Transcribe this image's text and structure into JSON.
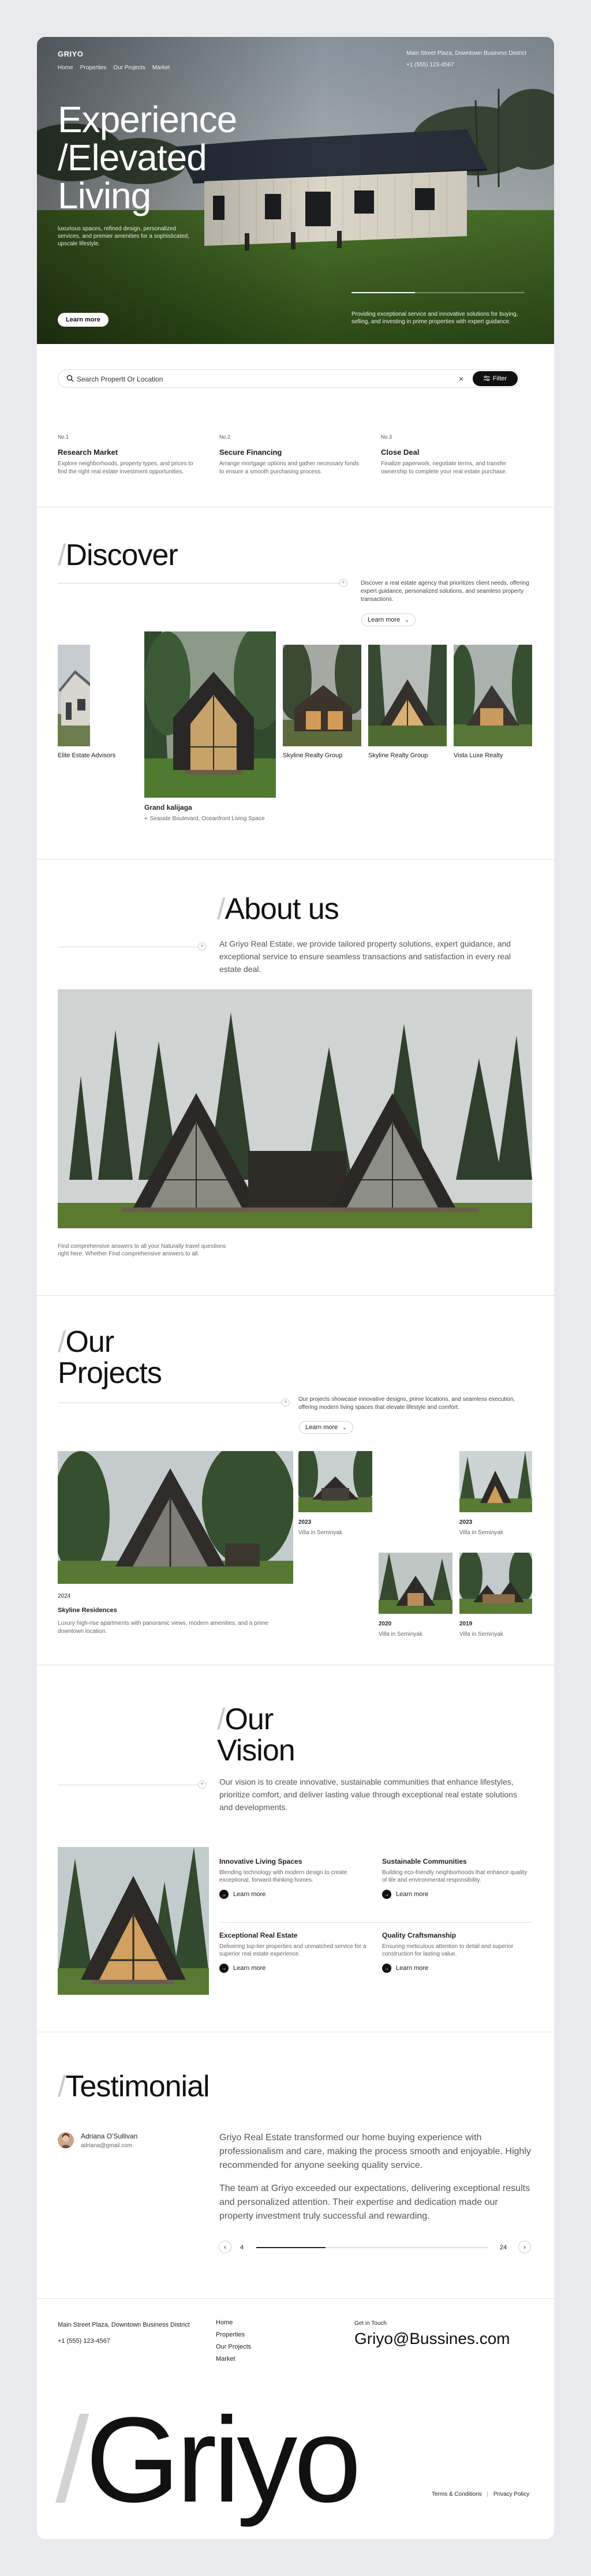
{
  "hero": {
    "brand": "GRIYO",
    "nav": [
      "Home",
      "Properties",
      "Our Projects",
      "Market"
    ],
    "contact_address": "Main Street Plaza, Downtown Business District",
    "contact_phone": "+1 (555) 123-4567",
    "headline_1": "Experience",
    "headline_2": "/Elevated",
    "headline_3": "Living",
    "subtext": "luxurious spaces, refined design, personalized services, and premier amenities for a sophisticated, upscale lifestyle.",
    "note": "Providing exceptional service and innovative solutions for buying, selling, and investing in prime properties with expert guidance.",
    "cta": "Learn more"
  },
  "search": {
    "placeholder": "Search Propertt Or Location",
    "clear": "×",
    "filter": "Filter"
  },
  "steps": [
    {
      "num": "No.1",
      "title": "Research Market",
      "desc": "Explore neighborhoods, property types, and prices to find the right real estate investment opportunities."
    },
    {
      "num": "No.2",
      "title": "Secure Financing",
      "desc": "Arrange mortgage options and gather necessary funds to ensure a smooth purchasing process."
    },
    {
      "num": "No.3",
      "title": "Close Deal",
      "desc": "Finalize paperwork, negotiate terms, and transfer ownership to complete your real estate purchase."
    }
  ],
  "discover": {
    "slash": "/",
    "title": "Discover",
    "desc": "Discover a real estate agency that prioritizes client needs, offering expert guidance, personalized solutions, and seamless property transactions.",
    "cta": "Learn more",
    "items": [
      {
        "caption": "Elite Estate Advisors"
      },
      {
        "caption": "Grand kalijaga",
        "sub": "Seaside Boulevard, Oceanfront Living Space"
      },
      {
        "caption": "Skyline Realty Group"
      },
      {
        "caption": "Skyline Realty Group"
      },
      {
        "caption": "Vista Luxe Realty"
      }
    ]
  },
  "about": {
    "slash": "/",
    "title": "About us",
    "desc": "At Griyo Real Estate, we provide tailored property solutions, expert guidance, and exceptional service to ensure seamless transactions and satisfaction in every real estate deal.",
    "footnote": "Find comprehensive answers to all your Naturally travel questions right here. Whether Find comprehensive answers to all."
  },
  "projects": {
    "slash": "/",
    "title_1": "Our",
    "title_2": "Projects",
    "desc": "Our projects showcase innovative designs, prime locations, and seamless execution, offering modern living spaces that elevate lifestyle and comfort.",
    "cta": "Learn more",
    "featured": {
      "year": "2024",
      "name": "Skyline Residences",
      "desc": "Luxury high-rise apartments with panoramic views, modern amenities, and a prime downtown location."
    },
    "items": [
      {
        "year": "2023",
        "name": "Villa in Seminyak"
      },
      {
        "year": "2023",
        "name": "Villa in Seminyak"
      },
      {
        "year": "2020",
        "name": "Villa in Seminyak"
      },
      {
        "year": "2019",
        "name": "Villa in Seminyak"
      }
    ]
  },
  "vision": {
    "slash": "/",
    "title_1": "Our",
    "title_2": "Vision",
    "desc": "Our vision is to create innovative, sustainable communities that enhance lifestyles, prioritize comfort, and deliver lasting value through exceptional real estate solutions and developments.",
    "link": "Learn more",
    "features": [
      {
        "title": "Innovative Living Spaces",
        "desc": "Blending technology with modern design to create exceptional, forward-thinking homes."
      },
      {
        "title": "Sustainable Communities",
        "desc": "Building eco-friendly neighborhoods that enhance quality of life and environmental responsibility."
      },
      {
        "title": "Exceptional Real Estate",
        "desc": "Delivering top-tier properties and unmatched service for a superior real estate experience."
      },
      {
        "title": "Quality Craftsmanship",
        "desc": "Ensuring meticulous attention to detail and superior construction for lasting value."
      }
    ]
  },
  "testimonial": {
    "slash": "/",
    "title": "Testimonial",
    "name": "Adriana O'Sullivan",
    "email": "adriana@gmail.com",
    "quote_1": "Griyo Real Estate transformed our home buying experience with professionalism and care, making the process smooth and enjoyable. Highly recommended for anyone seeking quality service.",
    "quote_2": "The team at Griyo exceeded our expectations, delivering exceptional results and personalized attention. Their expertise and dedication made our property investment truly successful and rewarding.",
    "page_current": "4",
    "page_total": "24"
  },
  "footer": {
    "address": "Main Street Plaza, Downtown Business District",
    "phone": "+1 (555) 123-4567",
    "links": [
      "Home",
      "Properties",
      "Our Projects",
      "Market"
    ],
    "touch_label": "Get in Touch",
    "email": "Griyo@Bussines.com",
    "slash": "/",
    "big": "Griyo",
    "terms": "Terms & Conditions",
    "privacy": "Privacy Policy",
    "sep": "|"
  },
  "colors": {
    "page_bg": "#e9eaed",
    "card_bg": "#ffffff",
    "ink": "#111111",
    "muted": "#666666",
    "slash": "#c9c9c9"
  }
}
